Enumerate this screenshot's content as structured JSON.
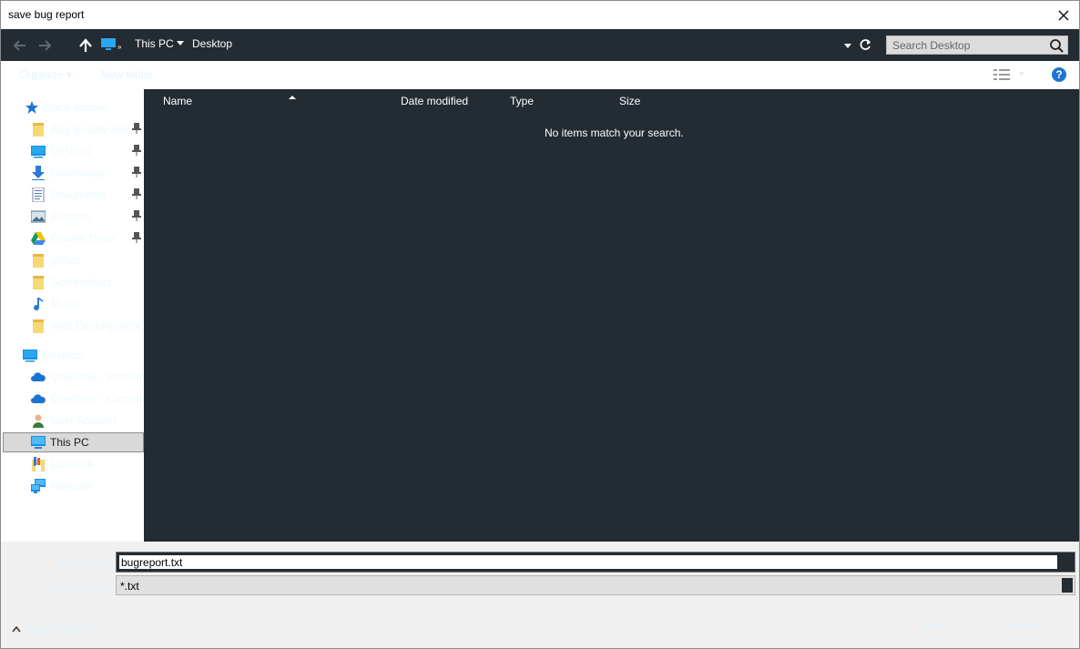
{
  "window": {
    "title": "save bug report"
  },
  "address": {
    "crumbs": [
      "This PC",
      "Desktop"
    ],
    "search_placeholder": "Search Desktop"
  },
  "toolbar": {
    "organize": "Organize ▾",
    "new_folder": "New folder"
  },
  "navpane": {
    "items": [
      {
        "label": "Quick access",
        "icon": "quick-access-star-icon",
        "pinned": false,
        "selected": false
      },
      {
        "label": "Bug Bounty Reports",
        "icon": "folder-icon",
        "pinned": true,
        "selected": false
      },
      {
        "label": "Desktop",
        "icon": "desktop-icon",
        "pinned": true,
        "selected": false
      },
      {
        "label": "Downloads",
        "icon": "downloads-icon",
        "pinned": true,
        "selected": false
      },
      {
        "label": "Documents",
        "icon": "documents-icon",
        "pinned": true,
        "selected": false
      },
      {
        "label": "Pictures",
        "icon": "pictures-icon",
        "pinned": true,
        "selected": false
      },
      {
        "label": "Google Drive",
        "icon": "google-drive-icon",
        "pinned": true,
        "selected": false
      },
      {
        "label": "github",
        "icon": "folder-icon",
        "pinned": false,
        "selected": false
      },
      {
        "label": "Screenshots",
        "icon": "folder-icon",
        "pinned": false,
        "selected": false
      },
      {
        "label": "Music",
        "icon": "music-icon",
        "pinned": false,
        "selected": false
      },
      {
        "label": "Web Development",
        "icon": "folder-icon",
        "pinned": false,
        "selected": false
      },
      {
        "label": "Desktop",
        "icon": "desktop-icon",
        "pinned": false,
        "selected": false
      },
      {
        "label": "OneDrive - Personal",
        "icon": "onedrive-icon",
        "pinned": false,
        "selected": false
      },
      {
        "label": "OneDrive - Company",
        "icon": "onedrive-icon",
        "pinned": false,
        "selected": false
      },
      {
        "label": "User Account",
        "icon": "user-icon",
        "pinned": false,
        "selected": false
      },
      {
        "label": "This PC",
        "icon": "this-pc-icon",
        "pinned": false,
        "selected": true
      },
      {
        "label": "Libraries",
        "icon": "libraries-icon",
        "pinned": false,
        "selected": false
      },
      {
        "label": "Network",
        "icon": "network-icon",
        "pinned": false,
        "selected": false
      }
    ]
  },
  "content": {
    "columns": [
      "Name",
      "Date modified",
      "Type",
      "Size"
    ],
    "empty_message": "No items match your search."
  },
  "bottom": {
    "file_name_label": "File name:",
    "file_name_value": "bugreport.txt",
    "save_type_label": "Save as type:",
    "save_type_value": "*.txt",
    "hide_folders_label": "Hide Folders",
    "save_label": "Save",
    "cancel_label": "Cancel"
  },
  "colors": {
    "dark_pane": "#232b33",
    "accent_blue": "#1b75d0",
    "selection_gray": "#d9d9d9"
  }
}
